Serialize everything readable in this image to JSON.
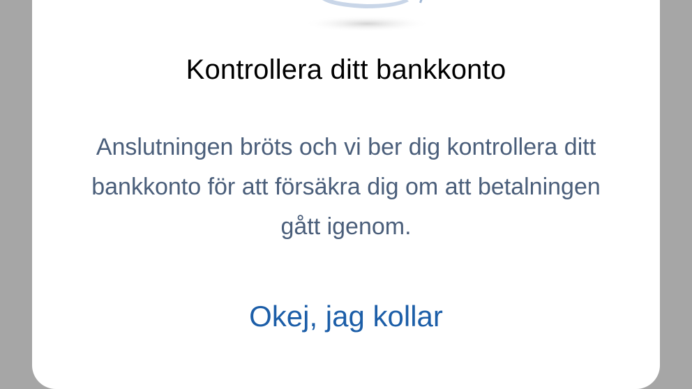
{
  "dialog": {
    "illustration_icon": "bank-card-illustration-icon",
    "title": "Kontrollera ditt bankkonto",
    "message": "Anslutningen bröts och vi ber dig kontrollera ditt bankkonto för att försäkra dig om att betalningen gått igenom.",
    "action_label": "Okej, jag kollar"
  },
  "colors": {
    "backdrop": "#a6a6a6",
    "dialog_bg": "#ffffff",
    "title": "#000000",
    "message": "#4a5e7a",
    "action": "#1c5ea8"
  }
}
